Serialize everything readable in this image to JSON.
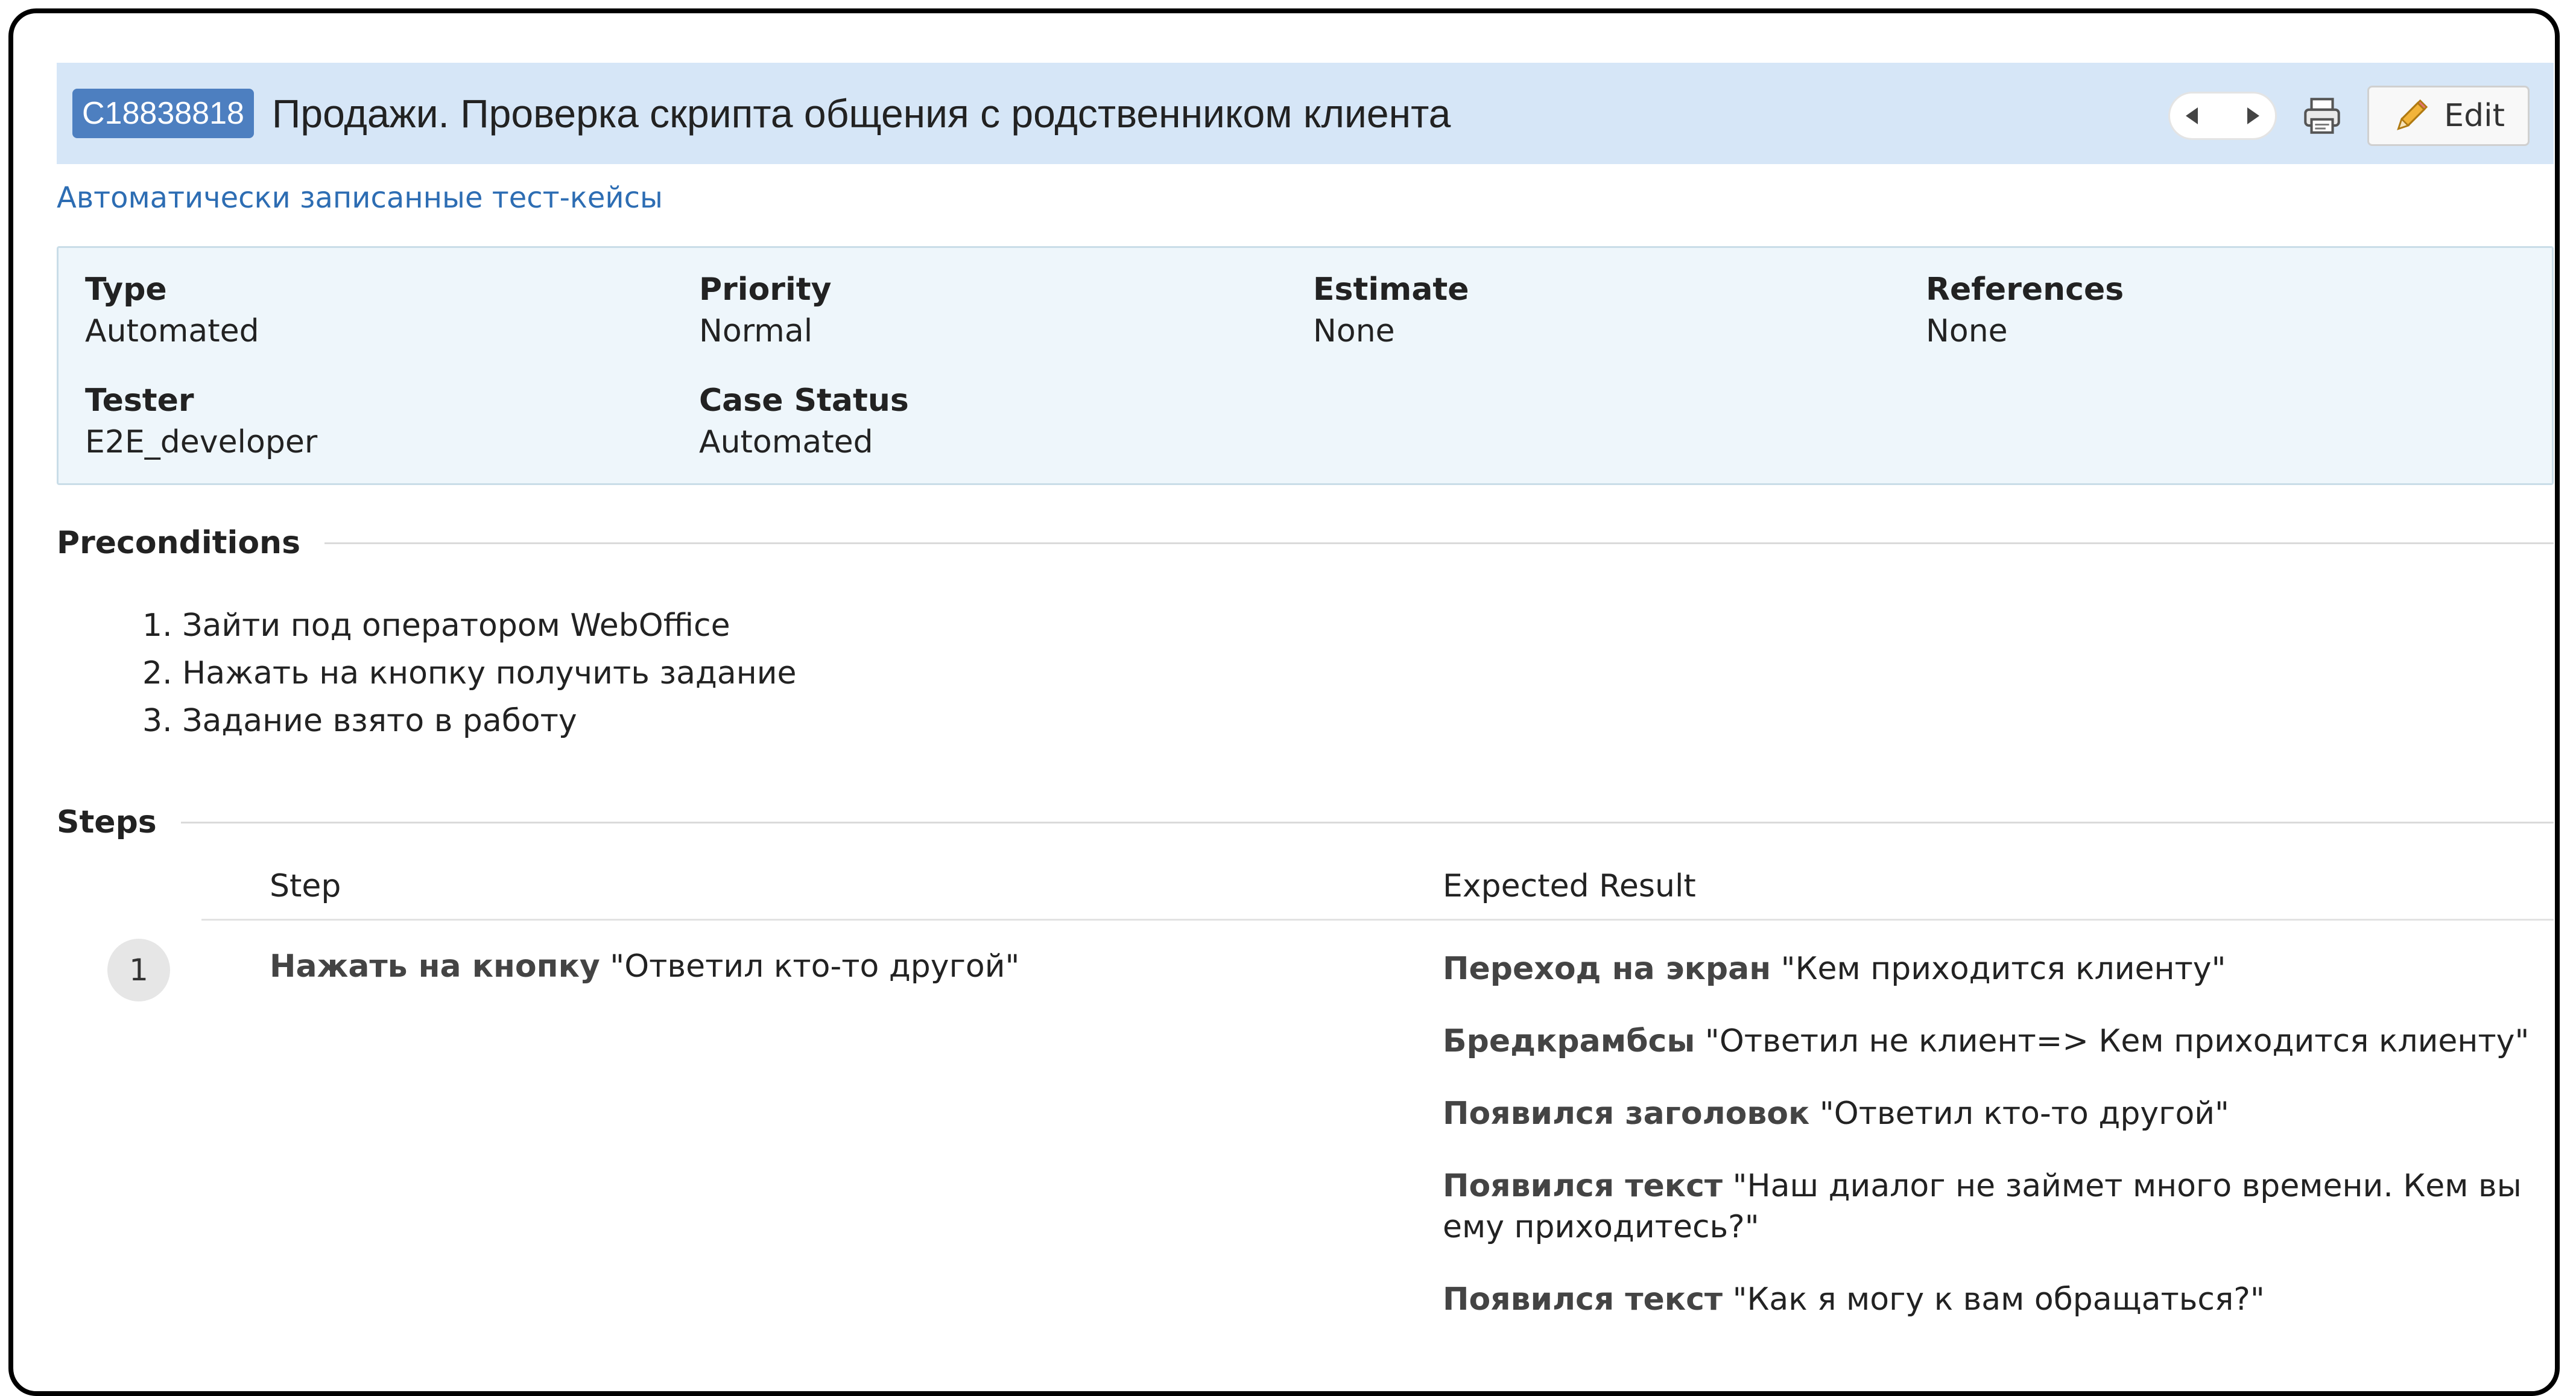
{
  "header": {
    "case_id": "C18838818",
    "title": "Продажи. Проверка скрипта общения с родственником клиента",
    "edit_label": "Edit"
  },
  "section_link": "Автоматически записанные тест-кейсы",
  "properties": {
    "type_label": "Type",
    "type_value": "Automated",
    "priority_label": "Priority",
    "priority_value": "Normal",
    "estimate_label": "Estimate",
    "estimate_value": "None",
    "references_label": "References",
    "references_value": "None",
    "tester_label": "Tester",
    "tester_value": "E2E_developer",
    "status_label": "Case Status",
    "status_value": "Automated"
  },
  "preconditions": {
    "title": "Preconditions",
    "items": [
      "1. Зайти под оператором WebOffice",
      "2. Нажать на кнопку получить задание",
      "3. Задание взято в работу"
    ]
  },
  "steps": {
    "title": "Steps",
    "col_step": "Step",
    "col_expected": "Expected Result",
    "rows": [
      {
        "number": "1",
        "step_bold": "Нажать на кнопку",
        "step_text": " \"Ответил кто-то другой\"",
        "expected": [
          {
            "bold": "Переход на экран",
            "text": " \"Кем приходится клиенту\""
          },
          {
            "bold": "Бредкрамбсы",
            "text": " \"Ответил не клиент=> Кем приходится клиенту\""
          },
          {
            "bold": "Появился заголовок",
            "text": " \"Ответил кто-то другой\""
          },
          {
            "bold": "Появился текст",
            "text": " \"Наш диалог не займет много времени. Кем вы ему приходитесь?\""
          },
          {
            "bold": "Появился текст",
            "text": " \"Как я могу к вам обращаться?\""
          }
        ]
      }
    ]
  },
  "icons": {
    "prev": "triangle-left-icon",
    "next": "triangle-right-icon",
    "print": "printer-icon",
    "edit": "pencil-icon"
  },
  "colors": {
    "header_bg": "#d6e6f7",
    "case_id_bg": "#4d7fc0",
    "link": "#2d6db3",
    "props_bg": "#eef6fb"
  }
}
